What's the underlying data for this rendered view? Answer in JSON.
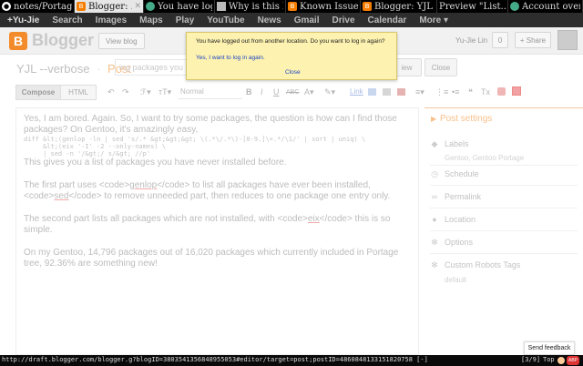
{
  "browser": {
    "tabs": [
      {
        "label": "notes/Portage",
        "icon": "github-icon",
        "active": false
      },
      {
        "label": "Blogger: ...",
        "icon": "blogger-icon",
        "active": true
      },
      {
        "label": "You have log...",
        "icon": "chrome-icon",
        "active": false
      },
      {
        "label": "Why is this h...",
        "icon": "page-icon",
        "active": false
      },
      {
        "label": "Known Issue...",
        "icon": "blogger-icon",
        "active": false
      },
      {
        "label": "Blogger: YJL ...",
        "icon": "blogger-icon",
        "active": false
      },
      {
        "label": "Preview \"List...",
        "icon": "",
        "active": false
      },
      {
        "label": "Account over...",
        "icon": "google-icon",
        "active": false
      }
    ]
  },
  "google_bar": {
    "items": [
      "+Yu-Jie",
      "Search",
      "Images",
      "Maps",
      "Play",
      "YouTube",
      "News",
      "Gmail",
      "Drive",
      "Calendar",
      "More ▾"
    ]
  },
  "header": {
    "logo_text": "Blogger",
    "view_blog": "View blog",
    "user_name": "Yu-Jie Lin",
    "notification_count": "0",
    "share_label": "+ Share"
  },
  "title_row": {
    "blog_name": "YJL --verbose",
    "separator": "·",
    "section": "Post",
    "title_value": "ing packages you ha",
    "preview_label": "iew",
    "close_label": "Close"
  },
  "toolbar": {
    "compose_label": "Compose",
    "html_label": "HTML",
    "undo": "↶",
    "redo": "↷",
    "font_icon": "ℱ▾",
    "size_icon": "ᴛT▾",
    "font_value": "Normal",
    "bold": "B",
    "italic": "I",
    "underline": "U",
    "strike": "ABC",
    "text_color": "A▾",
    "highlight": "✎▾",
    "link_label": "Link",
    "align": "≡▾",
    "numbered_list": "⋮≡",
    "bullet_list": "•≡",
    "quote": "❝",
    "clear_format": "Tx"
  },
  "editor": {
    "p1": "Yes, I am bored. Again. So, I want to try some packages, the question is how can I find those packages? On Gentoo, it's amazingly easy,",
    "code": "diff &lt;(genlop -ln | sed 's/.* &gt;&gt;&gt; \\(.*\\/.*\\)-[0-9.]\\+.*/\\1/' | sort | uniq) \\\n     &lt;(eix '-I' -2 --only-names) \\\n     | sed -n '/&gt;/ s/&gt; //p'",
    "p2": "This gives you a list of packages you have never installed before.",
    "p3a": "The first part uses <code>",
    "p3b": "genlop",
    "p3c": "</code> to list all packages have ever been installed, <code>",
    "p3d": "sed",
    "p3e": "</code> to remove unneeded part, then reduces to one package one entry only.",
    "p4a": "The second part lists all packages which are not installed, with <code>",
    "p4b": "eix",
    "p4c": "</code> this is so simple.",
    "p5": "On my Gentoo, 14,796 packages out of 16,020 packages which currently included in Portage tree, 92.36% are something new!"
  },
  "sidebar": {
    "title": "Post settings",
    "labels_title": "Labels",
    "labels_value": "Gentoo, Gentoo Portage",
    "schedule": "Schedule",
    "permalink": "Permalink",
    "location": "Location",
    "options": "Options",
    "robots_title": "Custom Robots Tags",
    "robots_value": "default"
  },
  "notice": {
    "message": "You have logged out from another location. Do you want to log in again?",
    "login_link": "Yes, I want to log in again.",
    "close_link": "Close"
  },
  "feedback": {
    "label": "Send feedback"
  },
  "status": {
    "url": "http://draft.blogger.com/blogger.g?blogID=3803541356848955053#editor/target=post;postID=4860848133151820758 [-]",
    "position": "[3/9]",
    "scroll": "Top",
    "adblock": "ABP"
  },
  "colors": {
    "blogger_orange": "#f57d00",
    "notice_bg": "#fdf2b0",
    "link_blue": "#1a44c4"
  }
}
